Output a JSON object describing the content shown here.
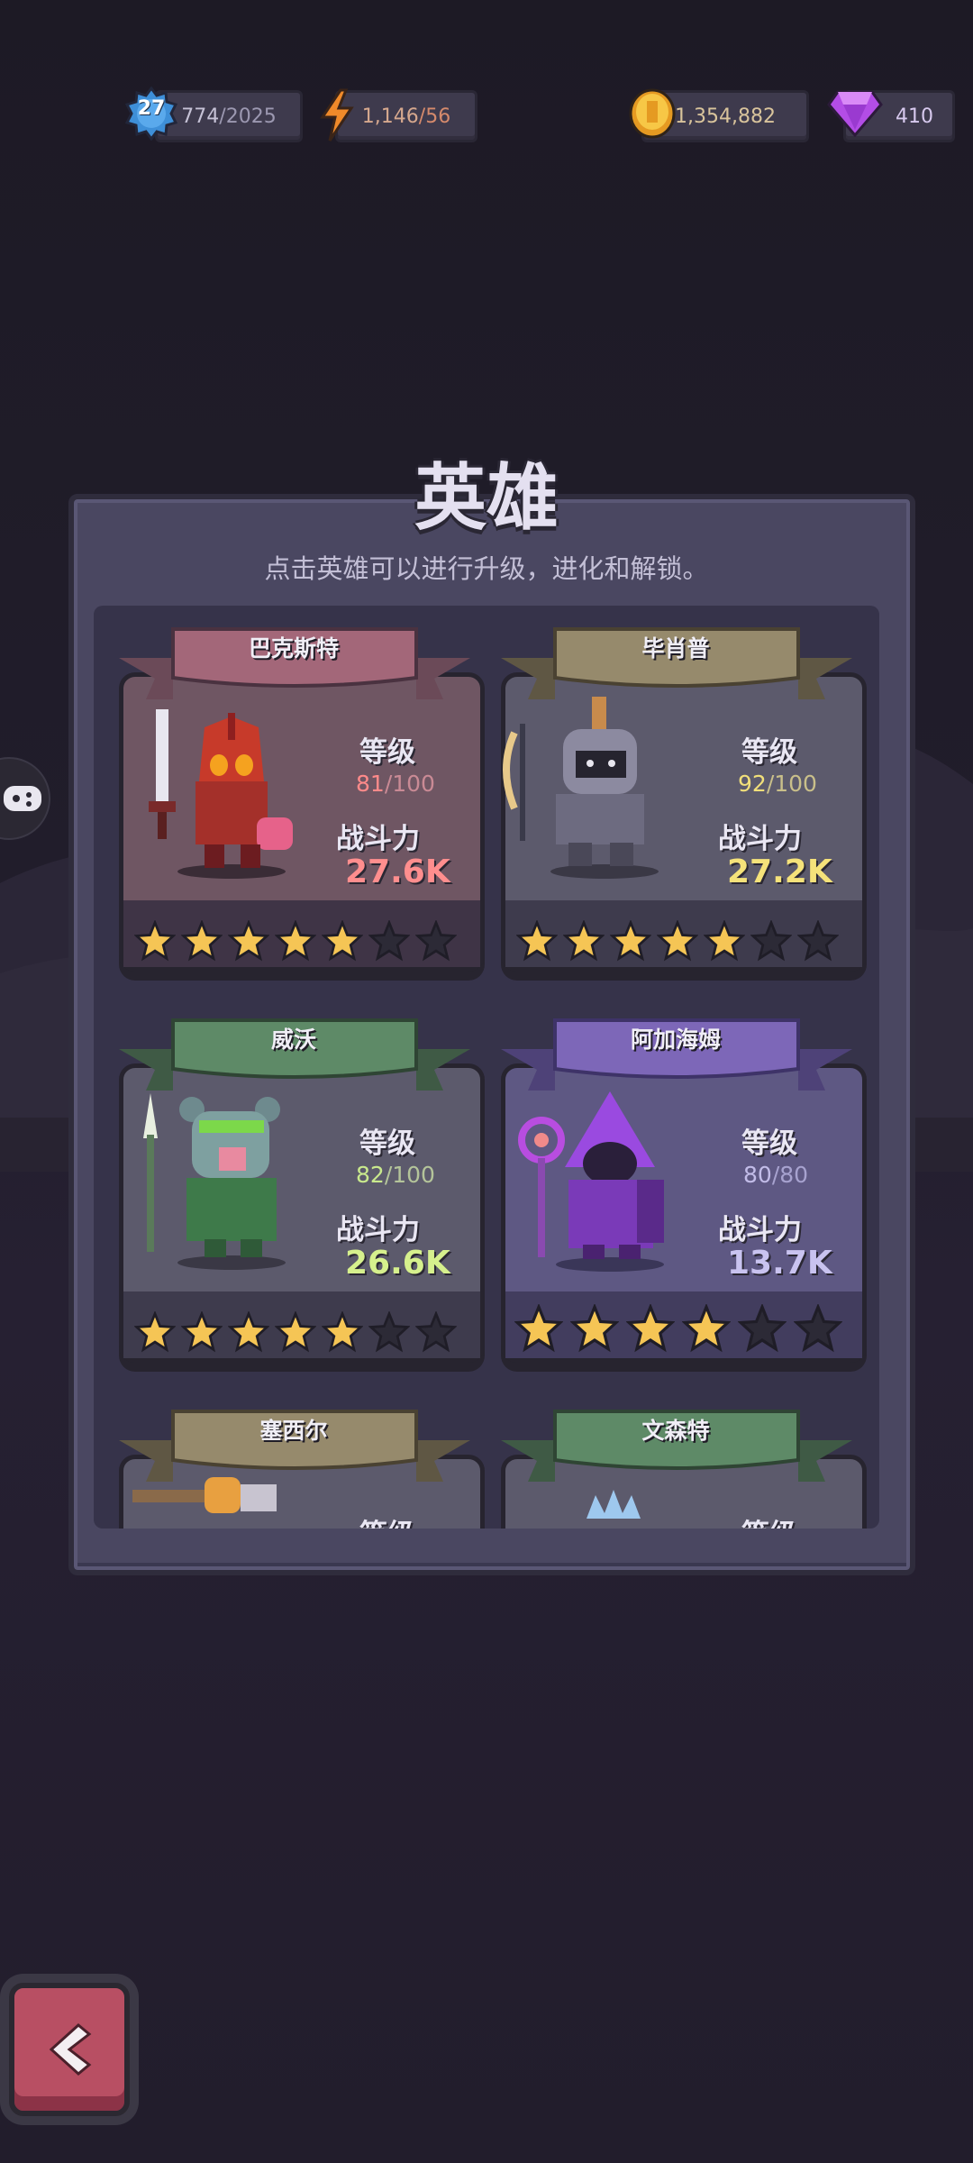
{
  "top_bar": {
    "player_level": "27",
    "xp_current": "774",
    "xp_total": "/2025",
    "energy_current": "1,146",
    "energy_max": "/56",
    "coins": "1,354,882",
    "gems": "410"
  },
  "panel": {
    "title": "英雄",
    "subtitle": "点击英雄可以进行升级，进化和解锁。"
  },
  "heroes": [
    {
      "name": "巴克斯特",
      "level_label": "等级",
      "level": "81",
      "level_max": "/100",
      "power_label": "战斗力",
      "power": "27.6K",
      "stars_filled": 5,
      "stars_total": 7,
      "level_color": "#ff8a8a",
      "power_color": "#ff8e8e"
    },
    {
      "name": "毕肖普",
      "level_label": "等级",
      "level": "92",
      "level_max": "/100",
      "power_label": "战斗力",
      "power": "27.2K",
      "stars_filled": 5,
      "stars_total": 7,
      "level_color": "#f1df7a",
      "power_color": "#f5e27a"
    },
    {
      "name": "威沃",
      "level_label": "等级",
      "level": "82",
      "level_max": "/100",
      "power_label": "战斗力",
      "power": "26.6K",
      "stars_filled": 5,
      "stars_total": 7,
      "level_color": "#c9e98d",
      "power_color": "#d6f08d"
    },
    {
      "name": "阿加海姆",
      "level_label": "等级",
      "level": "80",
      "level_max": "/80",
      "power_label": "战斗力",
      "power": "13.7K",
      "stars_filled": 4,
      "stars_total": 6,
      "level_color": "#c2bce8",
      "power_color": "#c9c3f0"
    },
    {
      "name": "塞西尔",
      "level_label": "等级"
    },
    {
      "name": "文森特",
      "level_label": "等级"
    }
  ],
  "colors": {
    "accent_star": "#f5c555",
    "back_button": "#b84f63"
  }
}
